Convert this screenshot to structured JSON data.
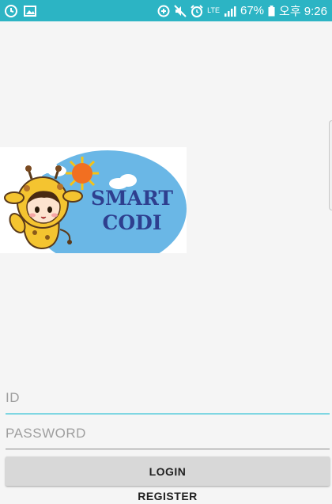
{
  "status_bar": {
    "left_icons": [
      "sync-icon",
      "image-icon"
    ],
    "right_icons": [
      "data-saver-icon",
      "mute-icon",
      "alarm-icon",
      "lte-icon",
      "signal-icon",
      "battery-icon"
    ],
    "network": "LTE",
    "battery": "67%",
    "time": "오후 9:26",
    "color": "#2cb4c4"
  },
  "logo": {
    "line1": "SMART",
    "line2": "CODI",
    "text_color": "#2e3f8f",
    "sky_color": "#6ab7e6",
    "sun_color": "#f26f21"
  },
  "form": {
    "id_placeholder": "ID",
    "password_placeholder": "PASSWORD",
    "login_label": "LOGIN",
    "register_label": "REGISTER",
    "accent_color": "#7fd6e2"
  }
}
